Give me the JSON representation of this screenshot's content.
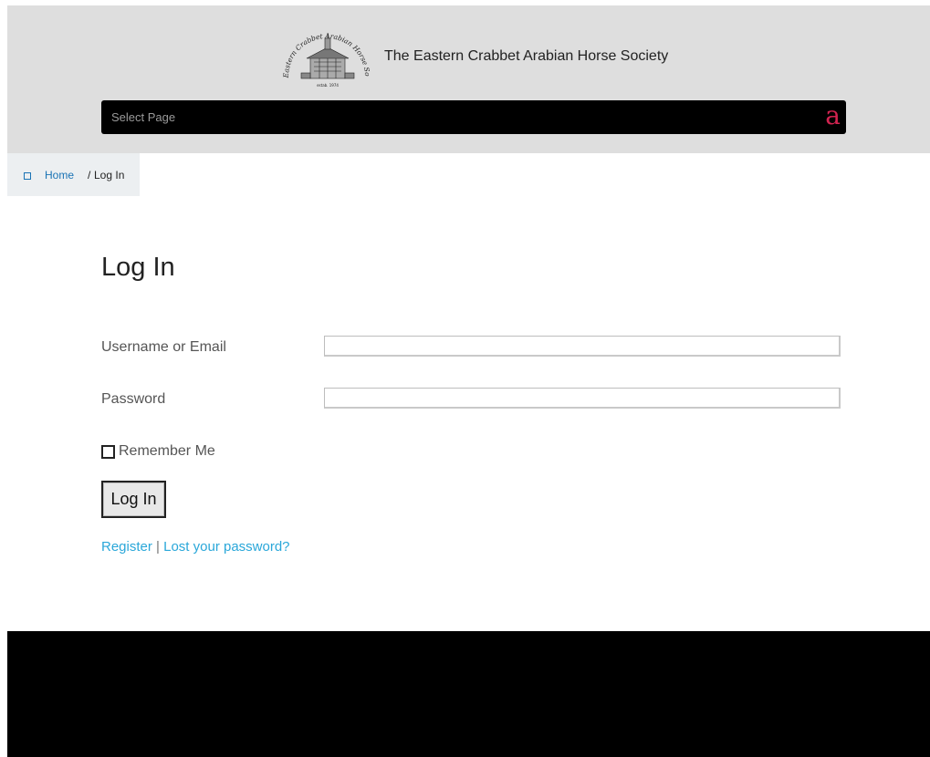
{
  "header": {
    "site_title": "The Eastern Crabbet Arabian Horse Society",
    "logo": {
      "icon": "society-seal-logo",
      "text_top": "The Eastern Crabbet Arabian Horse Society",
      "text_bottom": "estab. 1974"
    },
    "nav": {
      "label": "Select Page",
      "toggle_glyph": "a",
      "toggle_color": "#d12350"
    }
  },
  "breadcrumb": {
    "icon": "home-icon",
    "home_label": "Home",
    "separator": "/",
    "current_label": "Log In"
  },
  "page": {
    "title": "Log In"
  },
  "login_form": {
    "username_label": "Username or Email",
    "username_value": "",
    "password_label": "Password",
    "password_value": "",
    "remember_label": "Remember Me",
    "remember_checked": false,
    "submit_label": "Log In",
    "register_link": "Register",
    "links_separator": "|",
    "lost_password_link": "Lost your password?"
  },
  "colors": {
    "header_bg": "#dedede",
    "nav_bg": "#000000",
    "link": "#2aa7d9",
    "footer_bg": "#000000"
  }
}
